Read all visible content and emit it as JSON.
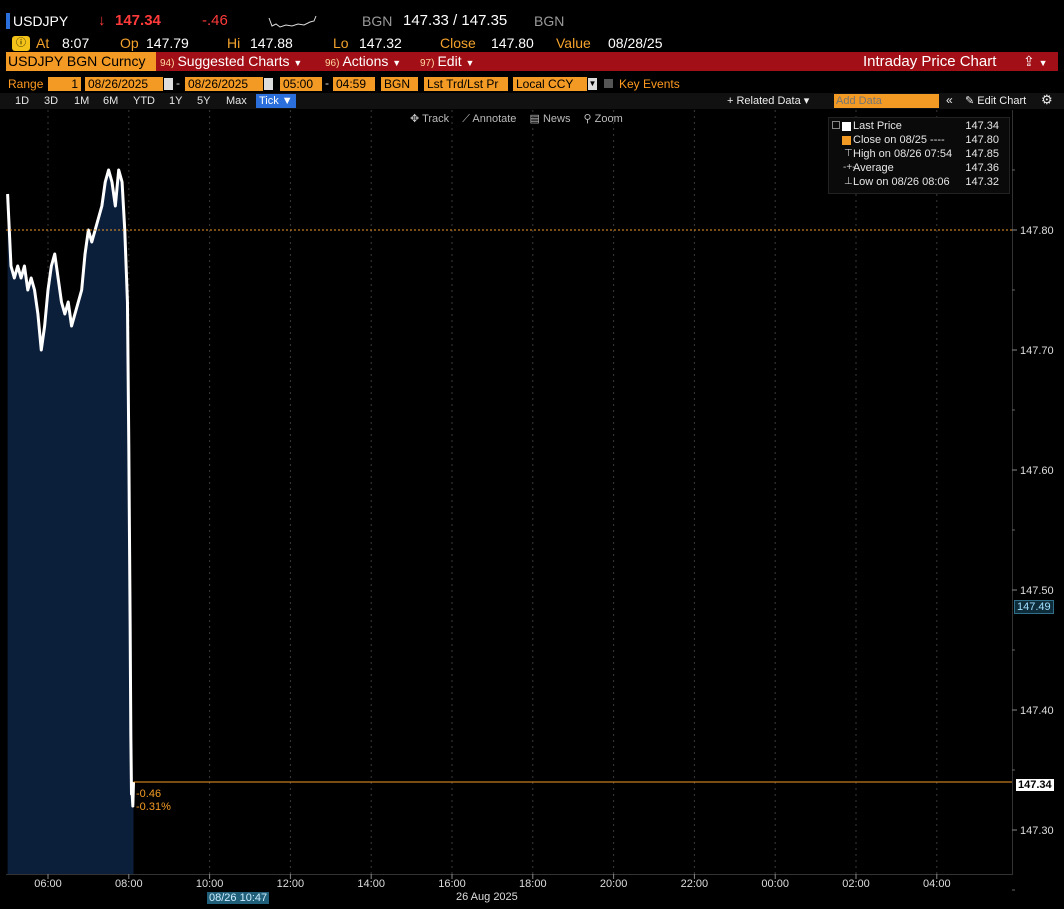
{
  "header": {
    "ticker": "USDJPY",
    "last": "147.34",
    "arrow": "↓",
    "change": "-.46",
    "source1": "BGN",
    "bid_ask": "147.33 / 147.35",
    "source2": "BGN",
    "at_label": "At",
    "at_time": "8:07",
    "op_label": "Op",
    "op_value": "147.79",
    "hi_label": "Hi",
    "hi_value": "147.88",
    "lo_label": "Lo",
    "lo_value": "147.32",
    "close_label": "Close",
    "close_value": "147.80",
    "value_label": "Value",
    "value_date": "08/28/25"
  },
  "menubar": {
    "security": "USDJPY BGN Curncy",
    "suggested_num": "94)",
    "suggested": "Suggested Charts",
    "actions_num": "96)",
    "actions": "Actions",
    "edit_num": "97)",
    "edit": "Edit",
    "title": "Intraday Price Chart"
  },
  "rangebar": {
    "range_label": "Range",
    "range_value": "1",
    "start_date": "08/26/2025",
    "end_date": "08/26/2025",
    "start_time": "05:00",
    "end_time": "04:59",
    "source": "BGN",
    "price_type": "Lst Trd/Lst Pr",
    "currency": "Local CCY",
    "key_events": "Key Events"
  },
  "timeframes": [
    "1D",
    "3D",
    "1M",
    "6M",
    "YTD",
    "1Y",
    "5Y",
    "Max"
  ],
  "timeframe_selected": "Tick ▼",
  "toolbar": {
    "related": "+ Related Data ▾",
    "add_data_placeholder": "Add Data",
    "edit_chart": "✎ Edit Chart"
  },
  "chart_tools": [
    "Track",
    "Annotate",
    "News",
    "Zoom"
  ],
  "legend": [
    {
      "label": "Last Price",
      "value": "147.34"
    },
    {
      "label": "Close on 08/25 ----",
      "value": "147.80"
    },
    {
      "label": "High on 08/26 07:54",
      "value": "147.85"
    },
    {
      "label": "Average",
      "value": "147.36"
    },
    {
      "label": "Low on 08/26 08:06",
      "value": "147.32"
    }
  ],
  "annotations": {
    "change_abs": "-0.46",
    "change_pct": "-0.31%",
    "crosshair_date": "08/26 10:47",
    "date_label": "26 Aug 2025",
    "last_tag": "147.34",
    "cursor_tag": "147.49"
  },
  "chart_data": {
    "type": "area",
    "y_ticks": [
      "147.80",
      "147.70",
      "147.60",
      "147.50",
      "147.40",
      "147.30"
    ],
    "x_ticks": [
      "06:00",
      "08:00",
      "10:00",
      "12:00",
      "14:00",
      "16:00",
      "18:00",
      "20:00",
      "22:00",
      "00:00",
      "02:00",
      "04:00"
    ],
    "ylim": [
      147.24,
      147.9
    ],
    "prev_close": 147.8,
    "last": 147.34,
    "series": [
      {
        "name": "Last Price",
        "x": [
          "05:00",
          "05:05",
          "05:10",
          "05:15",
          "05:20",
          "05:25",
          "05:30",
          "05:35",
          "05:40",
          "05:45",
          "05:50",
          "05:55",
          "06:00",
          "06:05",
          "06:10",
          "06:15",
          "06:20",
          "06:25",
          "06:30",
          "06:35",
          "06:40",
          "06:45",
          "06:50",
          "06:55",
          "07:00",
          "07:05",
          "07:10",
          "07:15",
          "07:20",
          "07:25",
          "07:30",
          "07:35",
          "07:40",
          "07:45",
          "07:50",
          "07:54",
          "07:58",
          "08:00",
          "08:02",
          "08:03",
          "08:04",
          "08:05",
          "08:06",
          "08:07"
        ],
        "values": [
          147.83,
          147.77,
          147.76,
          147.77,
          147.76,
          147.77,
          147.75,
          147.76,
          147.75,
          147.73,
          147.7,
          147.72,
          147.75,
          147.77,
          147.78,
          147.76,
          147.74,
          147.73,
          147.74,
          147.72,
          147.73,
          147.74,
          147.75,
          147.78,
          147.8,
          147.79,
          147.8,
          147.81,
          147.82,
          147.84,
          147.85,
          147.84,
          147.82,
          147.85,
          147.84,
          147.8,
          147.74,
          147.62,
          147.47,
          147.38,
          147.33,
          147.33,
          147.32,
          147.34
        ]
      }
    ]
  }
}
